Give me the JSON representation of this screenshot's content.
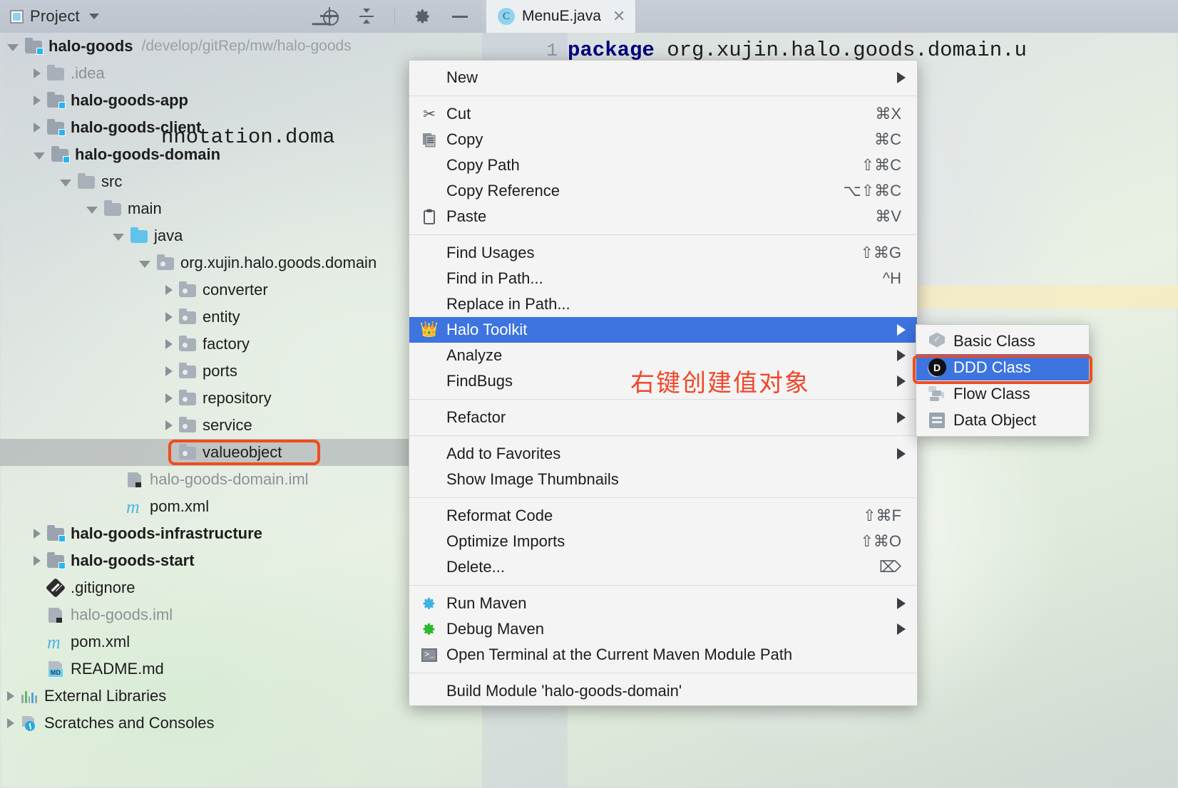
{
  "panel": {
    "title": "Project",
    "toolbar": [
      {
        "name": "locate-icon",
        "label": "Select Opened File"
      },
      {
        "name": "collapse-all-icon",
        "label": "Collapse All"
      },
      {
        "name": "gear-icon",
        "label": "Settings"
      },
      {
        "name": "minimize-icon",
        "label": "Hide"
      }
    ]
  },
  "tree": [
    {
      "indent": 0,
      "arrow": "open",
      "icon": "module-folder",
      "label": "halo-goods",
      "bold": true,
      "dim": false,
      "hint": "/develop/gitRep/mw/halo-goods"
    },
    {
      "indent": 1,
      "arrow": "closed",
      "icon": "folder-gray",
      "label": ".idea",
      "bold": false,
      "dim": true,
      "hint": ""
    },
    {
      "indent": 1,
      "arrow": "closed",
      "icon": "module-folder",
      "label": "halo-goods-app",
      "bold": true,
      "dim": false,
      "hint": ""
    },
    {
      "indent": 1,
      "arrow": "closed",
      "icon": "module-folder",
      "label": "halo-goods-client",
      "bold": true,
      "dim": false,
      "hint": ""
    },
    {
      "indent": 1,
      "arrow": "open",
      "icon": "module-folder",
      "label": "halo-goods-domain",
      "bold": true,
      "dim": false,
      "hint": ""
    },
    {
      "indent": 2,
      "arrow": "open",
      "icon": "folder-gray",
      "label": "src",
      "bold": false,
      "dim": false,
      "hint": ""
    },
    {
      "indent": 3,
      "arrow": "open",
      "icon": "folder-gray",
      "label": "main",
      "bold": false,
      "dim": false,
      "hint": ""
    },
    {
      "indent": 4,
      "arrow": "open",
      "icon": "folder-blue",
      "label": "java",
      "bold": false,
      "dim": false,
      "hint": ""
    },
    {
      "indent": 5,
      "arrow": "open",
      "icon": "package",
      "label": "org.xujin.halo.goods.domain",
      "bold": false,
      "dim": false,
      "hint": ""
    },
    {
      "indent": 6,
      "arrow": "closed",
      "icon": "package",
      "label": "converter",
      "bold": false,
      "dim": false,
      "hint": ""
    },
    {
      "indent": 6,
      "arrow": "closed",
      "icon": "package",
      "label": "entity",
      "bold": false,
      "dim": false,
      "hint": ""
    },
    {
      "indent": 6,
      "arrow": "closed",
      "icon": "package",
      "label": "factory",
      "bold": false,
      "dim": false,
      "hint": ""
    },
    {
      "indent": 6,
      "arrow": "closed",
      "icon": "package",
      "label": "ports",
      "bold": false,
      "dim": false,
      "hint": ""
    },
    {
      "indent": 6,
      "arrow": "closed",
      "icon": "package",
      "label": "repository",
      "bold": false,
      "dim": false,
      "hint": ""
    },
    {
      "indent": 6,
      "arrow": "closed",
      "icon": "package",
      "label": "service",
      "bold": false,
      "dim": false,
      "hint": ""
    },
    {
      "indent": 6,
      "arrow": "none",
      "icon": "package",
      "label": "valueobject",
      "bold": false,
      "dim": false,
      "hint": "",
      "selected": true,
      "outlined": true
    },
    {
      "indent": 4,
      "arrow": "none",
      "icon": "iml",
      "label": "halo-goods-domain.iml",
      "bold": false,
      "dim": true,
      "hint": ""
    },
    {
      "indent": 4,
      "arrow": "none",
      "icon": "maven",
      "label": "pom.xml",
      "bold": false,
      "dim": false,
      "hint": ""
    },
    {
      "indent": 1,
      "arrow": "closed",
      "icon": "module-folder",
      "label": "halo-goods-infrastructure",
      "bold": true,
      "dim": false,
      "hint": ""
    },
    {
      "indent": 1,
      "arrow": "closed",
      "icon": "module-folder",
      "label": "halo-goods-start",
      "bold": true,
      "dim": false,
      "hint": ""
    },
    {
      "indent": 1,
      "arrow": "none",
      "icon": "git",
      "label": ".gitignore",
      "bold": false,
      "dim": false,
      "hint": ""
    },
    {
      "indent": 1,
      "arrow": "none",
      "icon": "iml",
      "label": "halo-goods.iml",
      "bold": false,
      "dim": true,
      "hint": ""
    },
    {
      "indent": 1,
      "arrow": "none",
      "icon": "maven",
      "label": "pom.xml",
      "bold": false,
      "dim": false,
      "hint": ""
    },
    {
      "indent": 1,
      "arrow": "none",
      "icon": "markdown",
      "label": "README.md",
      "bold": false,
      "dim": false,
      "hint": ""
    },
    {
      "indent": 0,
      "arrow": "closed",
      "icon": "libraries",
      "label": "External Libraries",
      "bold": false,
      "dim": false,
      "hint": ""
    },
    {
      "indent": 0,
      "arrow": "closed",
      "icon": "scratches",
      "label": "Scratches and Consoles",
      "bold": false,
      "dim": false,
      "hint": ""
    }
  ],
  "editor": {
    "tab": {
      "name": "MenuE.java",
      "icon_letter": "C",
      "close_glyph": "✕"
    },
    "line_number": "1",
    "code_keyword": "package",
    "code_rest": " org.xujin.halo.goods.domain.u",
    "code_line2": "nnotation.doma"
  },
  "context_menu": {
    "groups": [
      {
        "items": [
          {
            "label": "New",
            "icon": "",
            "shortcut": "",
            "submenu": true
          }
        ]
      },
      {
        "items": [
          {
            "label": "Cut",
            "icon": "cut-icon",
            "shortcut": "⌘X",
            "submenu": false
          },
          {
            "label": "Copy",
            "icon": "copy-icon",
            "shortcut": "⌘C",
            "submenu": false
          },
          {
            "label": "Copy Path",
            "icon": "",
            "shortcut": "⇧⌘C",
            "submenu": false
          },
          {
            "label": "Copy Reference",
            "icon": "",
            "shortcut": "⌥⇧⌘C",
            "submenu": false
          },
          {
            "label": "Paste",
            "icon": "paste-icon",
            "shortcut": "⌘V",
            "submenu": false
          }
        ]
      },
      {
        "items": [
          {
            "label": "Find Usages",
            "icon": "",
            "shortcut": "⇧⌘G",
            "submenu": false
          },
          {
            "label": "Find in Path...",
            "icon": "",
            "shortcut": "^H",
            "submenu": false
          },
          {
            "label": "Replace in Path...",
            "icon": "",
            "shortcut": "",
            "submenu": false
          },
          {
            "label": "Halo Toolkit",
            "icon": "crown-icon",
            "shortcut": "",
            "submenu": true,
            "highlight": true
          },
          {
            "label": "Analyze",
            "icon": "",
            "shortcut": "",
            "submenu": true
          },
          {
            "label": "FindBugs",
            "icon": "",
            "shortcut": "",
            "submenu": true
          }
        ]
      },
      {
        "items": [
          {
            "label": "Refactor",
            "icon": "",
            "shortcut": "",
            "submenu": true
          }
        ]
      },
      {
        "items": [
          {
            "label": "Add to Favorites",
            "icon": "",
            "shortcut": "",
            "submenu": true
          },
          {
            "label": "Show Image Thumbnails",
            "icon": "",
            "shortcut": "",
            "submenu": false
          }
        ]
      },
      {
        "items": [
          {
            "label": "Reformat Code",
            "icon": "",
            "shortcut": "⇧⌘F",
            "submenu": false
          },
          {
            "label": "Optimize Imports",
            "icon": "",
            "shortcut": "⇧⌘O",
            "submenu": false
          },
          {
            "label": "Delete...",
            "icon": "",
            "shortcut": "⌦",
            "submenu": false
          }
        ]
      },
      {
        "items": [
          {
            "label": "Run Maven",
            "icon": "gear-blue-icon",
            "shortcut": "",
            "submenu": true
          },
          {
            "label": "Debug Maven",
            "icon": "gear-green-icon",
            "shortcut": "",
            "submenu": true
          },
          {
            "label": "Open Terminal at the Current Maven Module Path",
            "icon": "terminal-icon",
            "shortcut": "",
            "submenu": false
          }
        ]
      },
      {
        "items": [
          {
            "label": "Build Module 'halo-goods-domain'",
            "icon": "",
            "shortcut": "",
            "submenu": false
          }
        ]
      }
    ]
  },
  "submenu": {
    "items": [
      {
        "label": "Basic Class",
        "icon": "badge-icon",
        "highlight": false
      },
      {
        "label": "DDD Class",
        "icon": "ddd-d-icon",
        "highlight": true,
        "outlined": true
      },
      {
        "label": "Flow Class",
        "icon": "flow-icon",
        "highlight": false
      },
      {
        "label": "Data Object",
        "icon": "data-object-icon",
        "highlight": false
      }
    ]
  },
  "annotation": {
    "text": "右键创建值对象",
    "color": "#f0472a"
  },
  "colors": {
    "menu_highlight": "#3d74e0",
    "outline_red": "#f04c20",
    "annotation_red": "#f0472a",
    "module_badge_blue": "#28b6f0",
    "folder_blue": "#5fc3ec"
  }
}
